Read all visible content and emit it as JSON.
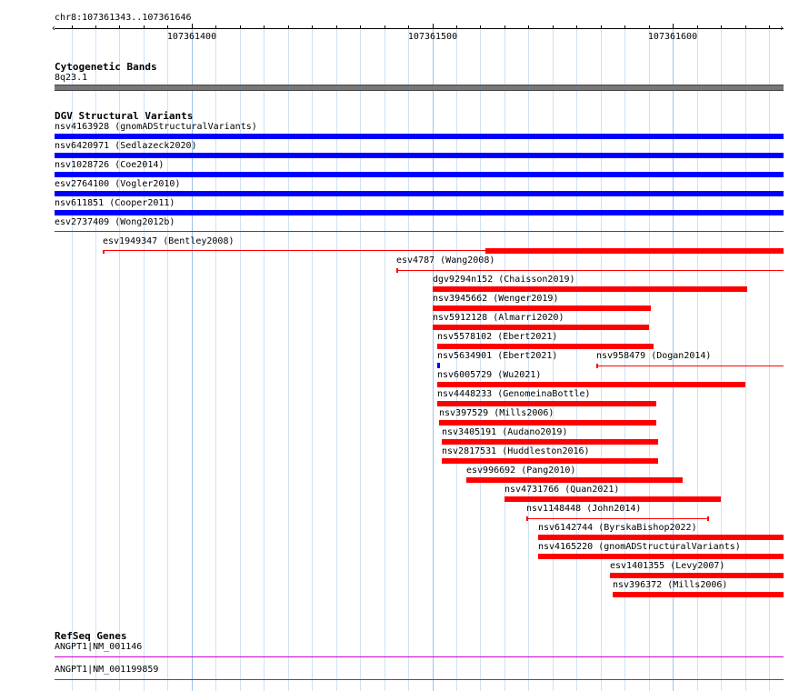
{
  "header": {
    "location": "chr8:107361343..107361646",
    "start": 107361343,
    "end": 107361646,
    "ticks": [
      {
        "pos": 107361400,
        "label": "107361400"
      },
      {
        "pos": 107361500,
        "label": "107361500"
      },
      {
        "pos": 107361600,
        "label": "107361600"
      }
    ],
    "minor_step": 10
  },
  "tracks": {
    "cytoband": {
      "title": "Cytogenetic Bands",
      "band": "8q23.1",
      "color": "#777777"
    },
    "dgv": {
      "title": "DGV Structural Variants",
      "colors": {
        "loss": "#ff0000",
        "gain": "#0000ff"
      },
      "full": [
        {
          "label": "nsv4163928 (gnomADStructuralVariants)",
          "type": "gain"
        },
        {
          "label": "nsv6420971 (Sedlazeck2020)",
          "type": "gain"
        },
        {
          "label": "nsv1028726 (Coe2014)",
          "type": "gain"
        },
        {
          "label": "esv2764100 (Vogler2010)",
          "type": "gain"
        },
        {
          "label": "nsv611851 (Cooper2011)",
          "type": "gain"
        },
        {
          "label": "esv2737409 (Wong2012b)",
          "type": "loss-thin"
        }
      ],
      "features": [
        {
          "label": "esv1949347 (Bentley2008)",
          "row": 0,
          "start": 107361363,
          "end": 107361646,
          "thick_start": 107361522,
          "type": "loss"
        },
        {
          "label": "esv4787 (Wang2008)",
          "row": 1,
          "start": 107361485,
          "end": 107361646,
          "type": "loss-thin"
        },
        {
          "label": "dgv9294n152 (Chaisson2019)",
          "row": 2,
          "start": 107361500,
          "end": 107361631,
          "type": "loss"
        },
        {
          "label": "nsv3945662 (Wenger2019)",
          "row": 3,
          "start": 107361500,
          "end": 107361591,
          "type": "loss"
        },
        {
          "label": "nsv5912128 (Almarri2020)",
          "row": 4,
          "start": 107361500,
          "end": 107361590,
          "type": "loss"
        },
        {
          "label": "nsv5578102 (Ebert2021)",
          "row": 5,
          "start": 107361502,
          "end": 107361592,
          "type": "loss"
        },
        {
          "label": "nsv5634901 (Ebert2021)",
          "row": 6,
          "start": 107361502,
          "end": 107361503,
          "type": "gain-tiny"
        },
        {
          "label": "nsv958479 (Dogan2014)",
          "row": 6,
          "start": 107361568,
          "end": 107361646,
          "type": "loss-thin"
        },
        {
          "label": "nsv6005729 (Wu2021)",
          "row": 7,
          "start": 107361502,
          "end": 107361630,
          "type": "loss"
        },
        {
          "label": "nsv4448233 (GenomeinaBottle)",
          "row": 8,
          "start": 107361502,
          "end": 107361593,
          "type": "loss"
        },
        {
          "label": "nsv397529 (Mills2006)",
          "row": 9,
          "start": 107361503,
          "end": 107361593,
          "type": "loss"
        },
        {
          "label": "nsv3405191 (Audano2019)",
          "row": 10,
          "start": 107361504,
          "end": 107361594,
          "type": "loss"
        },
        {
          "label": "nsv2817531 (Huddleston2016)",
          "row": 11,
          "start": 107361504,
          "end": 107361594,
          "type": "loss"
        },
        {
          "label": "esv996692 (Pang2010)",
          "row": 12,
          "start": 107361514,
          "end": 107361604,
          "type": "loss"
        },
        {
          "label": "nsv4731766 (Quan2021)",
          "row": 13,
          "start": 107361530,
          "end": 107361620,
          "type": "loss"
        },
        {
          "label": "nsv1148448 (John2014)",
          "row": 14,
          "start": 107361539,
          "end": 107361615,
          "type": "loss-thin"
        },
        {
          "label": "nsv6142744 (ByrskaBishop2022)",
          "row": 15,
          "start": 107361544,
          "end": 107361646,
          "type": "loss"
        },
        {
          "label": "nsv4165220 (gnomADStructuralVariants)",
          "row": 16,
          "start": 107361544,
          "end": 107361646,
          "type": "loss"
        },
        {
          "label": "esv1401355 (Levy2007)",
          "row": 17,
          "start": 107361574,
          "end": 107361646,
          "type": "loss"
        },
        {
          "label": "nsv396372 (Mills2006)",
          "row": 18,
          "start": 107361575,
          "end": 107361646,
          "type": "loss"
        }
      ]
    },
    "refseq": {
      "title": "RefSeq Genes",
      "color": "#cc00cc",
      "genes": [
        {
          "label": "ANGPT1|NM_001146"
        },
        {
          "label": "ANGPT1|NM_001199859"
        }
      ]
    }
  }
}
